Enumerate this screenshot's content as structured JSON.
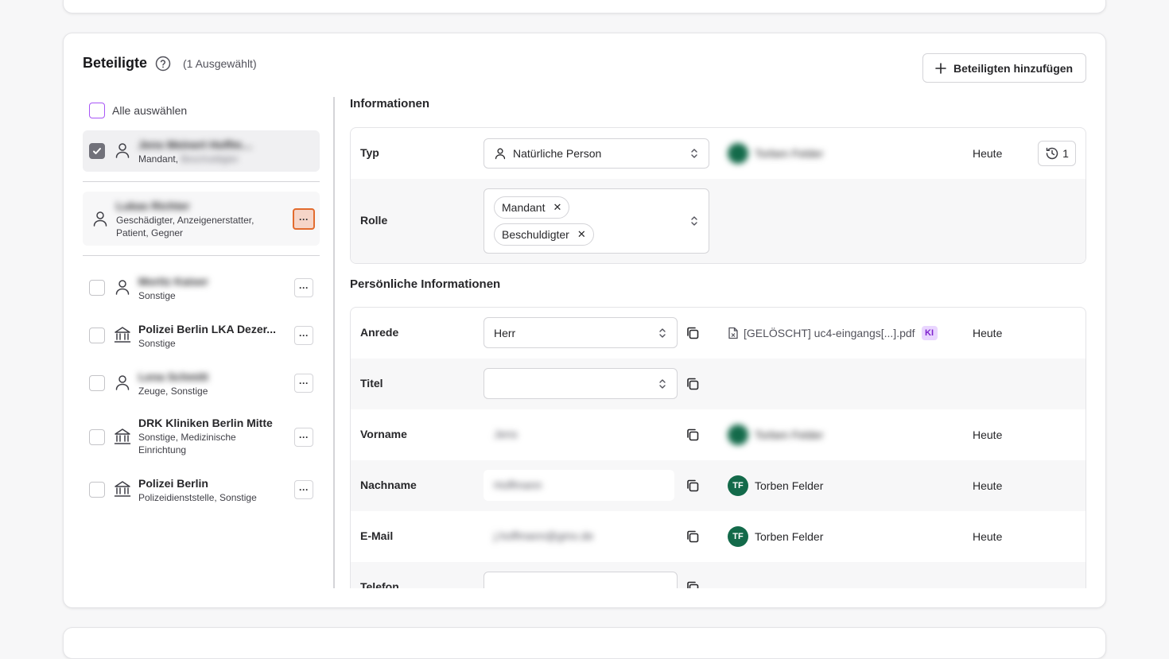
{
  "header": {
    "title": "Beteiligte",
    "selected_count": "(1 Ausgewählt)",
    "add_button": "Beteiligten hinzufügen"
  },
  "list": {
    "select_all": "Alle auswählen",
    "items": [
      {
        "name": "Jens Meinert Hoffmann",
        "role": "Mandant, Beschuldigter",
        "icon": "person-icon",
        "blurred_name": true,
        "checked": true
      },
      {
        "name": "Lukas Richter",
        "role": "Geschädigter, Anzeigenerstatter, Patient, Gegner",
        "icon": "person-icon",
        "blurred_name": true
      },
      {
        "name": "Moritz Kaiser",
        "role": "Sonstige",
        "icon": "person-icon",
        "blurred_name": true
      },
      {
        "name": "Polizei Berlin LKA Dezer...",
        "role": "Sonstige",
        "icon": "building-icon"
      },
      {
        "name": "Lena Schmitt",
        "role": "Zeuge, Sonstige",
        "icon": "person-icon",
        "blurred_name": true
      },
      {
        "name": "DRK Kliniken Berlin Mitte",
        "role": "Sonstige, Medizinische Einrichtung",
        "icon": "building-icon"
      },
      {
        "name": "Polizei Berlin",
        "role": "Polizeidienststelle, Sonstige",
        "icon": "building-icon"
      }
    ]
  },
  "info": {
    "title": "Informationen",
    "typ_label": "Typ",
    "typ_value": "Natürliche Person",
    "typ_source": "Torben Felder",
    "typ_date": "Heute",
    "history_count": "1",
    "rolle_label": "Rolle",
    "rolle_tags": [
      "Mandant",
      "Beschuldigter"
    ]
  },
  "personal": {
    "title": "Persönliche Informationen",
    "anrede_label": "Anrede",
    "anrede_value": "Herr",
    "anrede_source": "[GELÖSCHT] uc4-eingangs[...].pdf",
    "anrede_ki": "KI",
    "anrede_date": "Heute",
    "titel_label": "Titel",
    "vorname_label": "Vorname",
    "vorname_value": "Jens",
    "vorname_source": "Torben Felder",
    "vorname_date": "Heute",
    "nachname_label": "Nachname",
    "nachname_value": "Hoffmann",
    "nachname_avatar": "TF",
    "nachname_source": "Torben Felder",
    "nachname_date": "Heute",
    "email_label": "E-Mail",
    "email_value": "j.hoffmann@gmx.de",
    "email_avatar": "TF",
    "email_source": "Torben Felder",
    "email_date": "Heute",
    "telefon_label": "Telefon"
  },
  "colors": {
    "accent_purple": "#a855f7",
    "avatar_green": "#136a4a",
    "active_menu": "#e26b2e"
  }
}
